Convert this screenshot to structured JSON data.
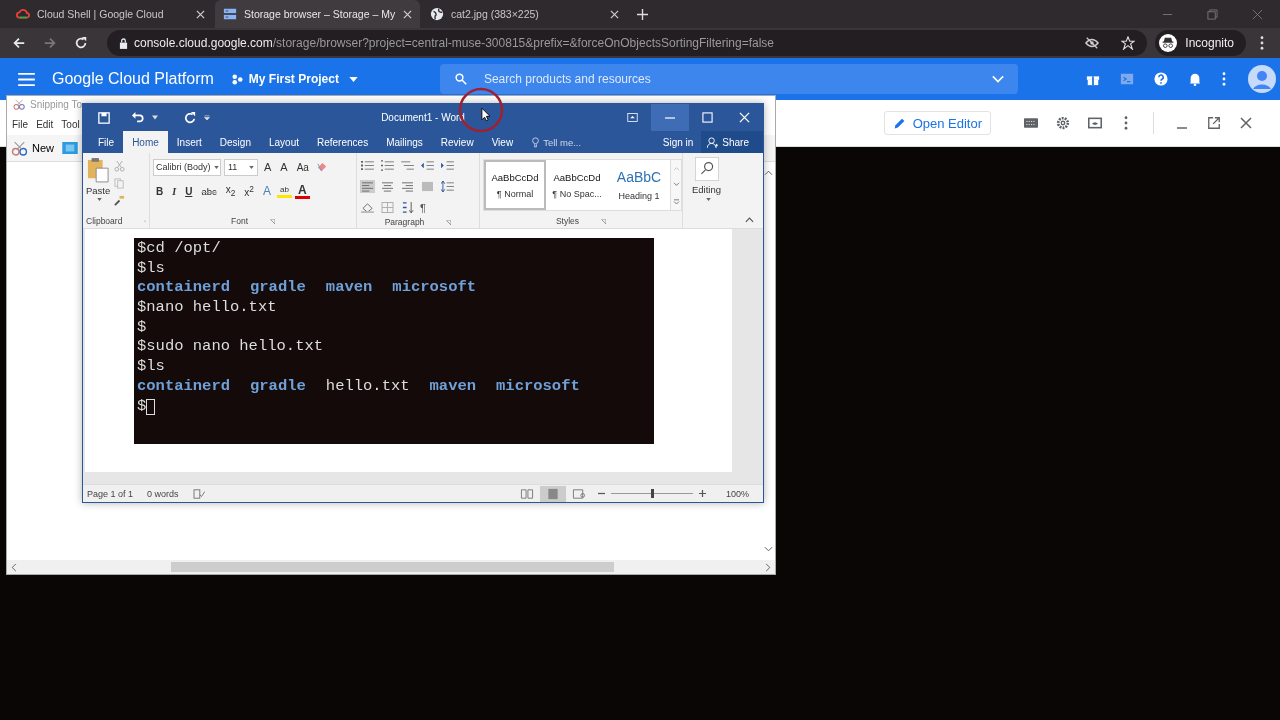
{
  "browser": {
    "tabs": [
      {
        "title": "Cloud Shell | Google Cloud",
        "kind": "cloud",
        "selected": false
      },
      {
        "title": "Storage browser – Storage – My",
        "kind": "storage",
        "selected": true
      },
      {
        "title": "cat2.jpg (383×225)",
        "kind": "globe",
        "selected": false
      }
    ],
    "address": {
      "host": "console.cloud.google.com",
      "path": "/storage/browser?project=central-muse-300815&prefix=&forceOnObjectsSortingFiltering=false"
    },
    "profile": "Incognito"
  },
  "console_header": {
    "product": "Google Cloud Platform",
    "project": "My First Project",
    "search": {
      "placeholder": "Search products and resources"
    }
  },
  "cloud_shell": {
    "open_editor": "Open Editor"
  },
  "snipping_tool": {
    "title": "Snipping To",
    "menu": [
      "File",
      "Edit",
      "Tool"
    ],
    "new_button": "New"
  },
  "word": {
    "title": "Document1 - Word",
    "tabs": [
      {
        "label": "File",
        "selected": false
      },
      {
        "label": "Home",
        "selected": true
      },
      {
        "label": "Insert",
        "selected": false
      },
      {
        "label": "Design",
        "selected": false
      },
      {
        "label": "Layout",
        "selected": false
      },
      {
        "label": "References",
        "selected": false
      },
      {
        "label": "Mailings",
        "selected": false
      },
      {
        "label": "Review",
        "selected": false
      },
      {
        "label": "View",
        "selected": false
      }
    ],
    "tell_me": "Tell me...",
    "sign_in": "Sign in",
    "share": "Share",
    "clipboard": {
      "paste": "Paste",
      "label": "Clipboard"
    },
    "font": {
      "name": "Calibri (Body)",
      "size": "11",
      "label": "Font",
      "top_buttons": [
        {
          "kind": "grow",
          "label": "A"
        },
        {
          "kind": "shrink",
          "label": "A"
        },
        {
          "kind": "case",
          "label": "Aa"
        }
      ],
      "buttons": [
        {
          "kind": "bold",
          "label": "B"
        },
        {
          "kind": "italic",
          "label": "I"
        },
        {
          "kind": "underline",
          "label": "U"
        },
        {
          "kind": "strike",
          "label": "abc"
        },
        {
          "kind": "sub",
          "label": "x$_{2}$"
        },
        {
          "kind": "sup",
          "label": "x$^{2}$"
        },
        {
          "kind": "effects",
          "label": "A"
        },
        {
          "kind": "highlight",
          "label": "ab"
        },
        {
          "kind": "color",
          "label": "A"
        }
      ]
    },
    "paragraph": {
      "label": "Paragraph",
      "pilcrow": "¶",
      "alignment": [
        {
          "kind": "left",
          "selected": true
        },
        {
          "kind": "center",
          "selected": false
        },
        {
          "kind": "right",
          "selected": false
        },
        {
          "kind": "justify",
          "selected": false
        }
      ]
    },
    "styles": {
      "label": "Styles",
      "items": [
        {
          "sample": "AaBbCcDd",
          "name": "¶ Normal",
          "kind": "body",
          "selected": true
        },
        {
          "sample": "AaBbCcDd",
          "name": "¶ No Spac...",
          "kind": "body",
          "selected": false
        },
        {
          "sample": "AaBbC",
          "name": "Heading 1",
          "kind": "heading",
          "selected": false
        }
      ]
    },
    "editing": "Editing",
    "terminal_lines": [
      {
        "kind": "command",
        "text": "$cd /opt/"
      },
      {
        "kind": "command",
        "text": "$ls"
      },
      {
        "kind": "listing",
        "items": [
          {
            "text": "containerd",
            "kind": "dir"
          },
          {
            "text": "gradle",
            "kind": "dir"
          },
          {
            "text": "maven",
            "kind": "dir"
          },
          {
            "text": "microsoft",
            "kind": "dir"
          }
        ]
      },
      {
        "kind": "command",
        "text": "$nano hello.txt"
      },
      {
        "kind": "command",
        "text": "$"
      },
      {
        "kind": "command",
        "text": "$sudo nano hello.txt"
      },
      {
        "kind": "command",
        "text": "$ls"
      },
      {
        "kind": "listing",
        "items": [
          {
            "text": "containerd",
            "kind": "dir"
          },
          {
            "text": "gradle",
            "kind": "dir"
          },
          {
            "text": "hello.txt",
            "kind": "file"
          },
          {
            "text": "maven",
            "kind": "dir"
          },
          {
            "text": "microsoft",
            "kind": "dir"
          }
        ]
      },
      {
        "kind": "cursor",
        "text": "$"
      }
    ],
    "status": {
      "page": "Page 1 of 1",
      "words": "0 words",
      "views": [
        {
          "kind": "read",
          "selected": false
        },
        {
          "kind": "print",
          "selected": true
        },
        {
          "kind": "web",
          "selected": false
        }
      ],
      "zoom": {
        "level": 0.5,
        "reading": "100%"
      }
    }
  }
}
